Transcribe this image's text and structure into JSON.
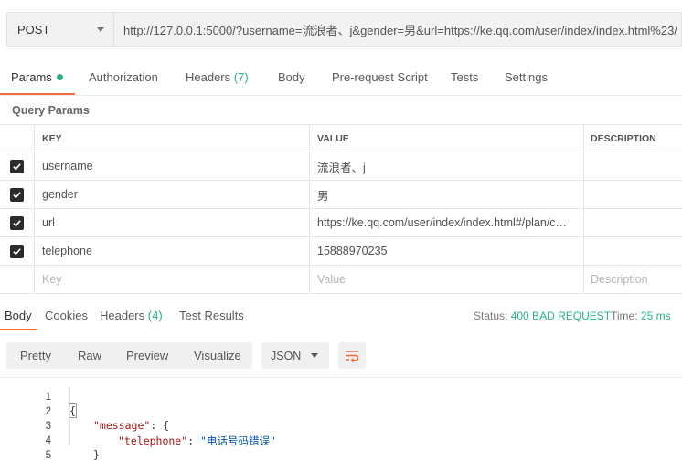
{
  "request": {
    "method": "POST",
    "url": "http://127.0.0.1:5000/?username=流浪者、j&gender=男&url=https://ke.qq.com/user/index/index.html%23/"
  },
  "request_tabs": {
    "params": "Params",
    "authorization": "Authorization",
    "headers": "Headers",
    "headers_count": "(7)",
    "body": "Body",
    "pre_request": "Pre-request Script",
    "tests": "Tests",
    "settings": "Settings"
  },
  "query_params": {
    "title": "Query Params",
    "columns": {
      "key": "KEY",
      "value": "VALUE",
      "description": "DESCRIPTION"
    },
    "rows": [
      {
        "key": "username",
        "value": "流浪者、j",
        "description": ""
      },
      {
        "key": "gender",
        "value": "男",
        "description": ""
      },
      {
        "key": "url",
        "value": "https://ke.qq.com/user/index/index.html#/plan/c…",
        "description": ""
      },
      {
        "key": "telephone",
        "value": "15888970235",
        "description": ""
      }
    ],
    "placeholders": {
      "key": "Key",
      "value": "Value",
      "description": "Description"
    }
  },
  "response_tabs": {
    "body": "Body",
    "cookies": "Cookies",
    "headers": "Headers",
    "headers_count": "(4)",
    "test_results": "Test Results"
  },
  "response_status": {
    "status_label": "Status:",
    "status_value": "400 BAD REQUEST",
    "time_label": "Time:",
    "time_value": "25 ms"
  },
  "response_toolbar": {
    "pretty": "Pretty",
    "raw": "Raw",
    "preview": "Preview",
    "visualize": "Visualize",
    "format": "JSON",
    "wrap_icon": "wrap-lines-icon"
  },
  "response_body": {
    "line_numbers": [
      "1",
      "2",
      "3",
      "4",
      "5"
    ],
    "open_brace": "{",
    "message_key": "\"message\"",
    "colon_open": ": {",
    "telephone_key": "\"telephone\"",
    "colon": ": ",
    "telephone_value": "\"电话号码错误\"",
    "inner_close": "}",
    "close_brace": "}"
  },
  "colors": {
    "accent": "#f26b3a",
    "success": "#26b47f"
  }
}
